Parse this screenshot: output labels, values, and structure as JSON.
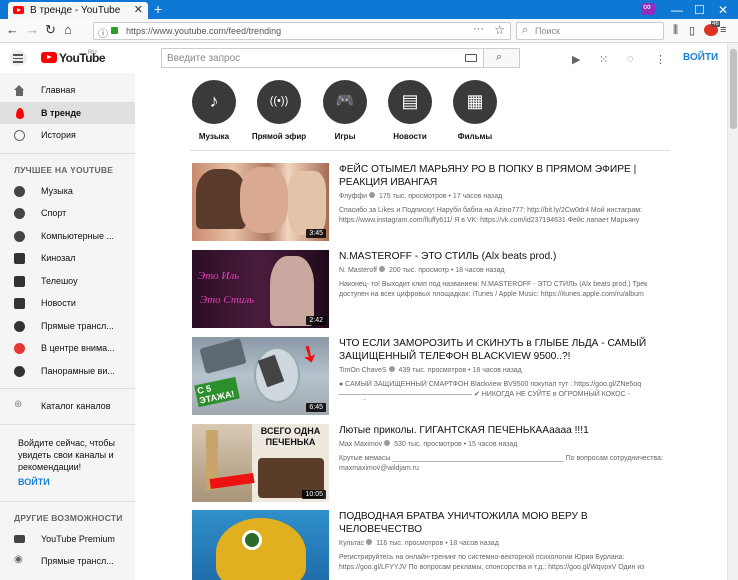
{
  "browser": {
    "tab_title": "В тренде - YouTube",
    "tab_close": "✕",
    "new_tab": "+",
    "url": "https://www.youtube.com/feed/trending",
    "search_placeholder": "Поиск",
    "minimize": "—",
    "maximize": "☐",
    "close": "✕",
    "badge_count": "46"
  },
  "header": {
    "logo_text": "YouTube",
    "logo_region": "RU",
    "search_placeholder": "Введите запрос",
    "signin_label": "ВОЙТИ"
  },
  "sidebar": {
    "main_items": [
      {
        "label": "Главная",
        "icon": "home-icon"
      },
      {
        "label": "В тренде",
        "icon": "fire-icon"
      },
      {
        "label": "История",
        "icon": "history-icon"
      }
    ],
    "best_heading": "ЛУЧШЕЕ НА YOUTUBE",
    "best_items": [
      {
        "label": "Музыка",
        "color": "#444444"
      },
      {
        "label": "Спорт",
        "color": "#444444"
      },
      {
        "label": "Компьютерные ...",
        "color": "#444444"
      },
      {
        "label": "Кинозал",
        "color": "#333333"
      },
      {
        "label": "Телешоу",
        "color": "#333333"
      },
      {
        "label": "Новости",
        "color": "#333333"
      },
      {
        "label": "Прямые трансл...",
        "color": "#333333"
      },
      {
        "label": "В центре внима...",
        "color": "#e53935"
      },
      {
        "label": "Панорамные ви...",
        "color": "#333333"
      }
    ],
    "catalog_label": "Каталог каналов",
    "signin_prompt": "Войдите сейчас, чтобы увидеть свои каналы и рекомендации!",
    "signin_label": "ВОЙТИ",
    "other_heading": "ДРУГИЕ ВОЗМОЖНОСТИ",
    "other_items": [
      {
        "label": "YouTube Premium"
      },
      {
        "label": "Прямые трансл..."
      }
    ]
  },
  "categories": [
    {
      "label": "Музыка",
      "glyph": "♪"
    },
    {
      "label": "Прямой эфир",
      "glyph": "((•))"
    },
    {
      "label": "Игры",
      "glyph": "🎮"
    },
    {
      "label": "Новости",
      "glyph": "▤"
    },
    {
      "label": "Фильмы",
      "glyph": "▦"
    }
  ],
  "videos": [
    {
      "title": "ФЕЙС ОТЫМЕЛ МАРЬЯНУ РО В ПОПКУ В ПРЯМОМ ЭФИРЕ | РЕАКЦИЯ ИВАНГАЯ",
      "channel": "Флуффи",
      "views": "175 тыс. просмотров",
      "age": "17 часов назад",
      "desc": "Спасибо за Likes и Подписку! Наруби бабла на Azino777: http://bit.ly/2Cw0dr4 Мой инстаграм: https://www.instagram.com/fluffy611/ Я в VK: https://vk.com/id237194631 Фейс лапает Марьяну",
      "duration": "3:45"
    },
    {
      "title": "N.MASTEROFF - ЭТО СТИЛЬ (Alx beats prod.)",
      "channel": "N. Masteroff",
      "views": "200 тыс. просмотр",
      "age": "18 часов назад",
      "desc": "Наконец- то! Выходит клип под названием: N.MASTEROFF - ЭТО СТИЛЬ (Alx beats prod.) Трек доступен на всех цифровых площадках: iTunes / Apple Music: https://itunes.apple.com/ru/album",
      "duration": "2:42"
    },
    {
      "title": "ЧТО ЕСЛИ ЗАМОРОЗИТЬ И СКИНУТЬ в ГЛЫБЕ ЛЬДА - САМЫЙ ЗАЩИЩЕННЫЙ ТЕЛЕФОН BLACKVIEW 9500..?!",
      "channel": "TimOn ChaveS",
      "views": "439 тыс. просмотров",
      "age": "18 часов назад",
      "desc": "● САМЫЙ ЗАЩИЩЕННЫЙ СМАРТФОН Blackview BV9500 покупал тут : https://goo.gl/ZNe5oq ——————————————————— ✔ НИКОГДА НЕ СУЙТЕ в ОГРОМНЫЙ КОКОС - НАТРИЙ..!!! -",
      "duration": "6:45",
      "thumb_text": "С 5 ЭТАЖА!"
    },
    {
      "title": "Лютые приколы. ГИГАНТСКАЯ ПЕЧЕНЬКААаааа !!!1",
      "channel": "Max Maximov",
      "views": "530 тыс. просмотров",
      "age": "15 часов назад",
      "desc": "Крутые мемасы ____________________________________________ По вопросам сотрудничества: maxmaximov@wildjam.ru",
      "duration": "10:05",
      "thumb_text": "ВСЕГО ОДНА ПЕЧЕНЬКА"
    },
    {
      "title": "ПОДВОДНАЯ БРАТВА УНИЧТОЖИЛА МОЮ ВЕРУ В ЧЕЛОВЕЧЕСТВО",
      "channel": "Культас",
      "views": "116 тыс. просмотров",
      "age": "18 часов назад",
      "desc": "Регистрируйтесь на онлайн-тренинг по системно-векторной психологии Юрия Бурлана: https://goo.gl/LFYYJV По вопросам рекламы, спонсорства и т.д.: https://goo.gl/WqvpxV Один из",
      "duration": ""
    }
  ],
  "colors": {
    "accent": "#ff0000",
    "link": "#1e7fd6",
    "browser_tabbar": "#0f77d4"
  }
}
